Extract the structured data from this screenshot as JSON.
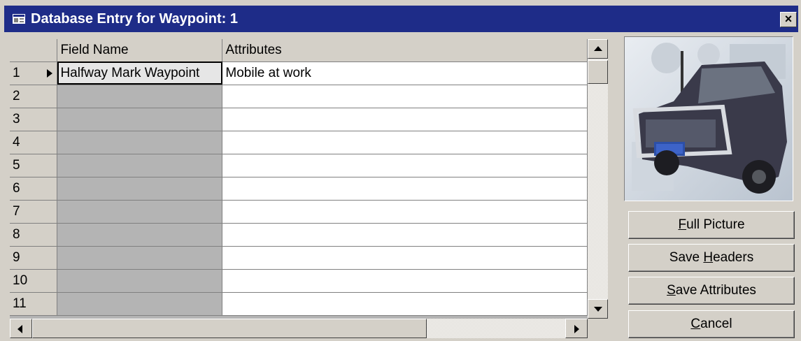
{
  "window": {
    "title": "Database Entry for Waypoint: 1",
    "close_label": "×"
  },
  "grid": {
    "columns": [
      "Field Name",
      "Attributes"
    ],
    "rows": [
      {
        "num": "1",
        "field": "Halfway Mark Waypoint",
        "attr": "Mobile at work",
        "current": true
      },
      {
        "num": "2",
        "field": "",
        "attr": ""
      },
      {
        "num": "3",
        "field": "",
        "attr": ""
      },
      {
        "num": "4",
        "field": "",
        "attr": ""
      },
      {
        "num": "5",
        "field": "",
        "attr": ""
      },
      {
        "num": "6",
        "field": "",
        "attr": ""
      },
      {
        "num": "7",
        "field": "",
        "attr": ""
      },
      {
        "num": "8",
        "field": "",
        "attr": ""
      },
      {
        "num": "9",
        "field": "",
        "attr": ""
      },
      {
        "num": "10",
        "field": "",
        "attr": ""
      },
      {
        "num": "11",
        "field": "",
        "attr": ""
      }
    ]
  },
  "picture": {
    "icon": "vehicle-photo"
  },
  "buttons": {
    "full_picture": {
      "pre": "",
      "key": "F",
      "post": "ull Picture"
    },
    "save_headers": {
      "pre": "Save ",
      "key": "H",
      "post": "eaders"
    },
    "save_attributes": {
      "pre": "",
      "key": "S",
      "post": "ave Attributes"
    },
    "cancel": {
      "pre": "",
      "key": "C",
      "post": "ancel"
    }
  },
  "colors": {
    "titlebar": "#1e2c88",
    "face": "#d4d0c8"
  }
}
